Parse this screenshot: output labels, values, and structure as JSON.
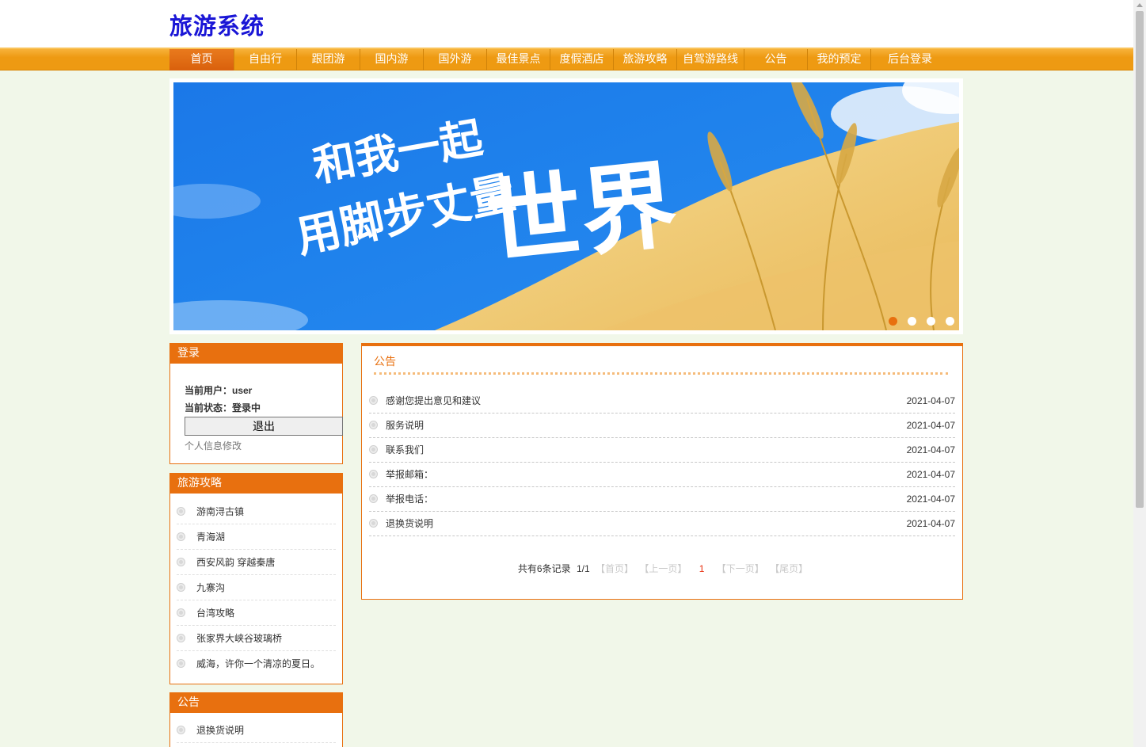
{
  "site": {
    "logo": "旅游系统"
  },
  "nav": {
    "items": [
      {
        "label": "首页",
        "active": true
      },
      {
        "label": "自由行"
      },
      {
        "label": "跟团游"
      },
      {
        "label": "国内游"
      },
      {
        "label": "国外游"
      },
      {
        "label": "最佳景点"
      },
      {
        "label": "度假酒店"
      },
      {
        "label": "旅游攻略"
      },
      {
        "label": "自驾游路线"
      },
      {
        "label": "公告"
      },
      {
        "label": "我的预定"
      },
      {
        "label": "后台登录"
      }
    ]
  },
  "banner": {
    "slogan_line1": "和我一起",
    "slogan_line2": "用脚步丈量",
    "slogan_big": "世界",
    "dots": 4,
    "active_dot": 0
  },
  "login": {
    "title": "登录",
    "user_line": "当前用户：user",
    "status_line": "当前状态：登录中",
    "logout_label": "退出",
    "profile_link": "个人信息修改"
  },
  "guides": {
    "title": "旅游攻略",
    "items": [
      "游南浔古镇",
      "青海湖",
      "西安风韵 穿越秦唐",
      "九寨沟",
      "台湾攻略",
      "张家界大峡谷玻璃桥",
      "威海，许你一个清凉的夏日。"
    ]
  },
  "side_notice": {
    "title": "公告",
    "items": [
      "退换货说明"
    ]
  },
  "notice": {
    "title": "公告",
    "items": [
      {
        "title": "感谢您提出意见和建议",
        "date": "2021-04-07"
      },
      {
        "title": "服务说明",
        "date": "2021-04-07"
      },
      {
        "title": "联系我们",
        "date": "2021-04-07"
      },
      {
        "title": "举报邮箱：",
        "date": "2021-04-07"
      },
      {
        "title": "举报电话：",
        "date": "2021-04-07"
      },
      {
        "title": "退换货说明",
        "date": "2021-04-07"
      }
    ],
    "pager": {
      "total": "共有6条记录",
      "page": "1/1",
      "first": "【首页】",
      "prev": "【上一页】",
      "current": "1",
      "next": "【下一页】",
      "last": "【尾页】"
    }
  },
  "colors": {
    "accent": "#e8700f",
    "nav": "#ee9a12",
    "logo": "#1a16d6",
    "background": "#f1f7e9"
  }
}
